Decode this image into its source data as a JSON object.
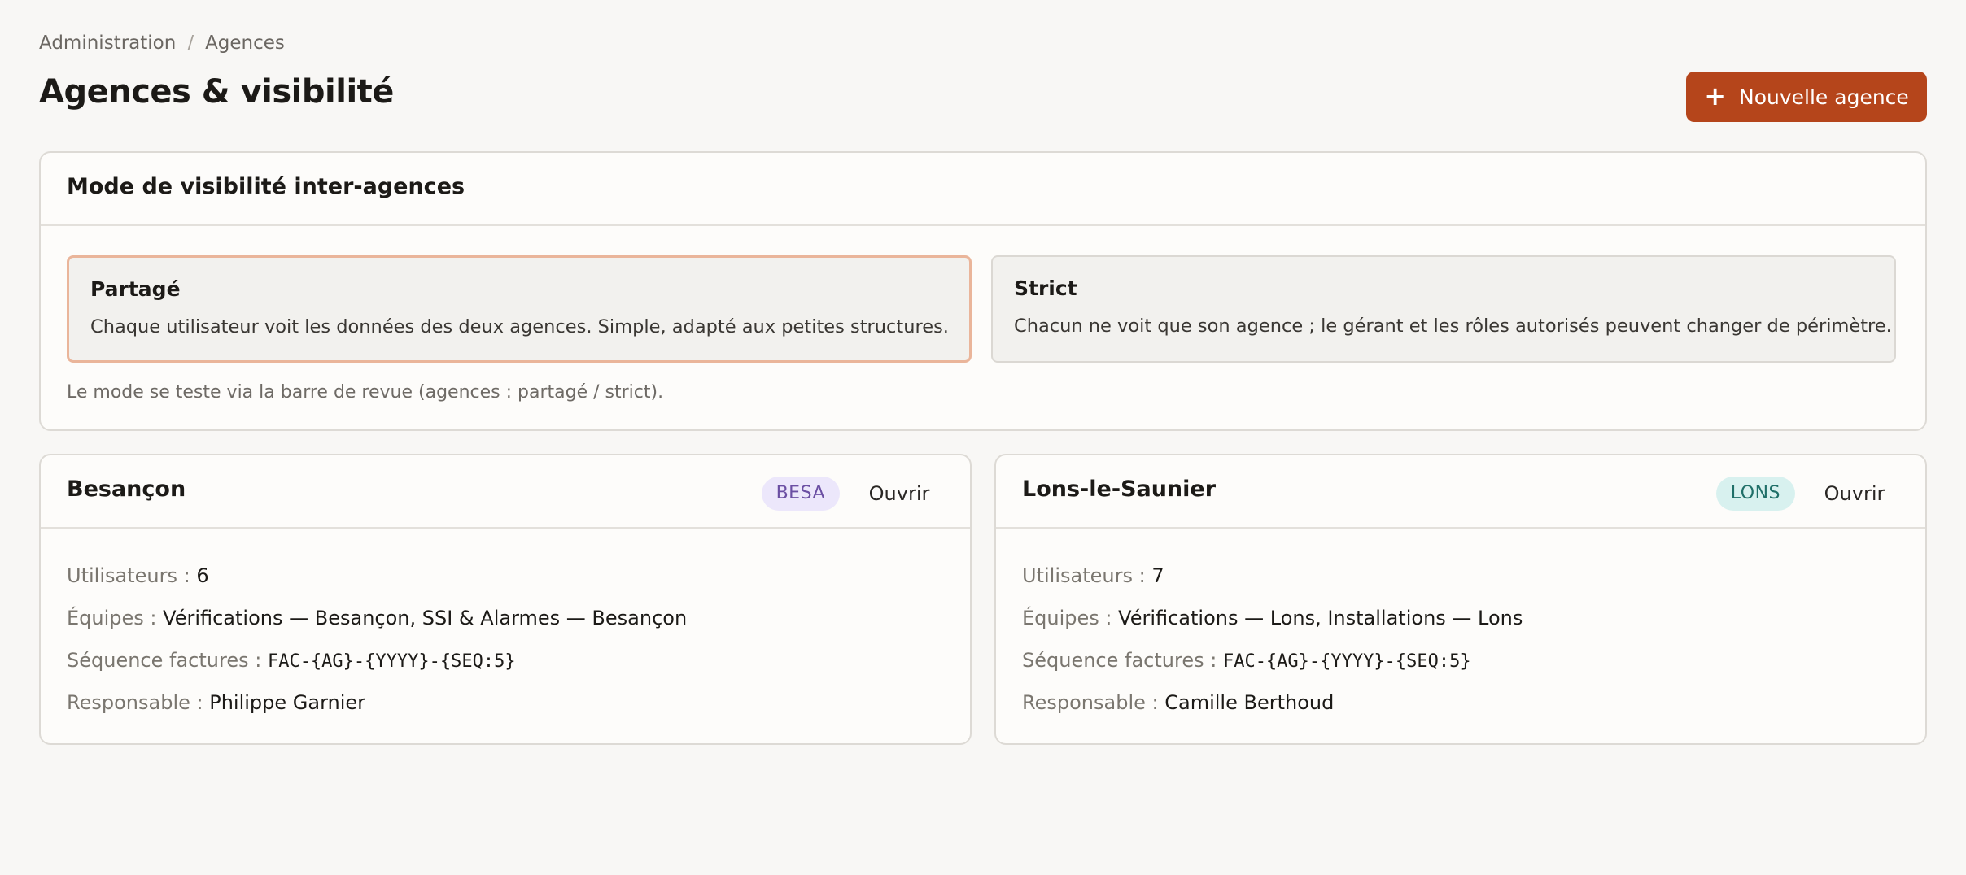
{
  "breadcrumb": {
    "items": [
      "Administration",
      "Agences"
    ],
    "separator": "/"
  },
  "header": {
    "title": "Agences & visibilité",
    "new_button_label": "Nouvelle agence",
    "new_button_icon": "+"
  },
  "visibility": {
    "title": "Mode de visibilité inter-agences",
    "options": [
      {
        "title": "Partagé",
        "description": "Chaque utilisateur voit les données des deux agences. Simple, adapté aux petites structures.",
        "selected": true
      },
      {
        "title": "Strict",
        "description": "Chacun ne voit que son agence ; le gérant et les rôles autorisés peuvent changer de périmètre.",
        "selected": false
      }
    ],
    "note": "Le mode se teste via la barre de revue (agences : partagé / strict)."
  },
  "agencies": [
    {
      "name": "Besançon",
      "code": "BESA",
      "open_label": "Ouvrir",
      "users_label": "Utilisateurs :",
      "users": "6",
      "teams_label": "Équipes :",
      "teams": "Vérifications — Besançon, SSI & Alarmes — Besançon",
      "sequence_label": "Séquence factures :",
      "sequence": "FAC-{AG}-{YYYY}-{SEQ:5}",
      "manager_label": "Responsable :",
      "manager": "Philippe Garnier"
    },
    {
      "name": "Lons-le-Saunier",
      "code": "LONS",
      "open_label": "Ouvrir",
      "users_label": "Utilisateurs :",
      "users": "7",
      "teams_label": "Équipes :",
      "teams": "Vérifications — Lons, Installations — Lons",
      "sequence_label": "Séquence factures :",
      "sequence": "FAC-{AG}-{YYYY}-{SEQ:5}",
      "manager_label": "Responsable :",
      "manager": "Camille Berthoud"
    }
  ],
  "colors": {
    "accent": "#b5451b",
    "selected_border": "#eab59a",
    "besa_badge": "#ece7fb",
    "lons_badge": "#d8f1ef"
  }
}
